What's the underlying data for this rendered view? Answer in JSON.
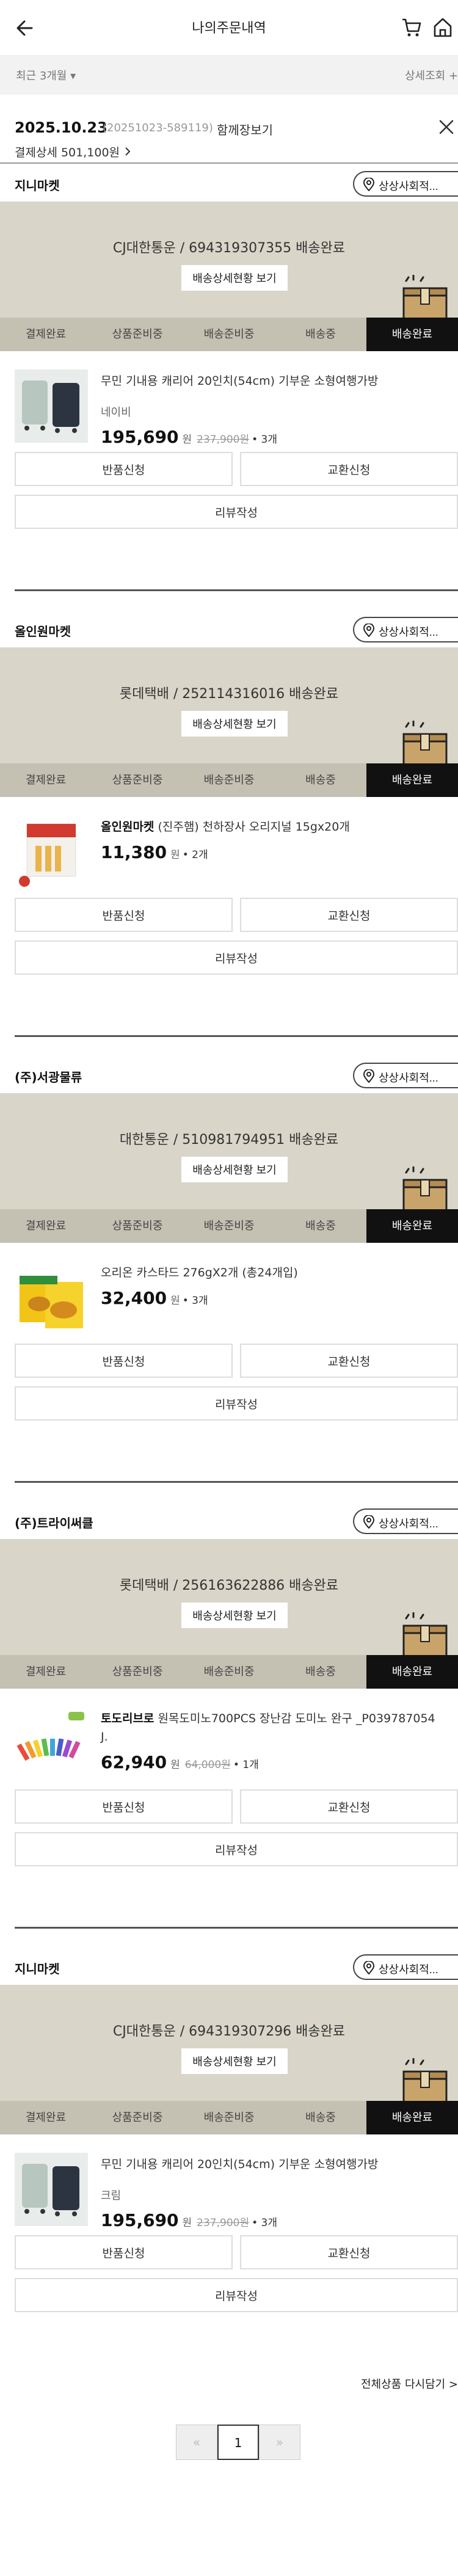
{
  "header": {
    "title": "나의주문내역"
  },
  "filter": {
    "period_label": "최근 3개월 ▾",
    "detail_search_label": "상세조회 +"
  },
  "order": {
    "date": "2025.10.23",
    "order_no": "(20251023-589119)",
    "together_label": "함께장보기",
    "pay_detail_label": "결제상세 501,100원"
  },
  "steps": [
    "결제완료",
    "상품준비중",
    "배송준비중",
    "배송중",
    "배송완료"
  ],
  "shipments": [
    {
      "seller": "지니마켓",
      "store_btn": "상상사회적...",
      "carrier_line": "CJ대한통운 / 694319307355 배송완료",
      "detail_btn": "배송상세현황 보기",
      "item": {
        "brand": "",
        "name": "무민 기내용 캐리어 20인치(54cm) 기부운 소형여행가방",
        "option": "네이비",
        "price": "195,690",
        "won": "원",
        "orig": "237,900원",
        "qty": "• 3개"
      },
      "return_btn": "반품신청",
      "exchange_btn": "교환신청",
      "review_btn": "리뷰작성"
    },
    {
      "seller": "올인원마켓",
      "store_btn": "상상사회적...",
      "carrier_line": "롯데택배 / 252114316016 배송완료",
      "detail_btn": "배송상세현황 보기",
      "item": {
        "brand": "올인원마켓",
        "name": " (진주햄) 천하장사 오리지널 15gx20개",
        "option": "",
        "price": "11,380",
        "won": "원",
        "orig": "",
        "qty": "• 2개"
      },
      "return_btn": "반품신청",
      "exchange_btn": "교환신청",
      "review_btn": "리뷰작성"
    },
    {
      "seller": "(주)서광물류",
      "store_btn": "상상사회적...",
      "carrier_line": "대한통운 / 510981794951 배송완료",
      "detail_btn": "배송상세현황 보기",
      "item": {
        "brand": "",
        "name": "오리온 카스타드 276gX2개 (총24개입)",
        "option": "",
        "price": "32,400",
        "won": "원",
        "orig": "",
        "qty": "• 3개"
      },
      "return_btn": "반품신청",
      "exchange_btn": "교환신청",
      "review_btn": "리뷰작성"
    },
    {
      "seller": "(주)트라이써클",
      "store_btn": "상상사회적...",
      "carrier_line": "롯데택배 / 256163622886 배송완료",
      "detail_btn": "배송상세현황 보기",
      "item": {
        "brand": "토도리브로",
        "name": " 원목도미노700PCS 장난감 도미노 완구 _P039787054 J.",
        "option": "",
        "price": "62,940",
        "won": "원",
        "orig": "64,000원",
        "qty": "• 1개"
      },
      "return_btn": "반품신청",
      "exchange_btn": "교환신청",
      "review_btn": "리뷰작성"
    },
    {
      "seller": "지니마켓",
      "store_btn": "상상사회적...",
      "carrier_line": "CJ대한통운 / 694319307296 배송완료",
      "detail_btn": "배송상세현황 보기",
      "item": {
        "brand": "",
        "name": "무민 기내용 캐리어 20인치(54cm) 기부운 소형여행가방",
        "option": "크림",
        "price": "195,690",
        "won": "원",
        "orig": "237,900원",
        "qty": "• 3개"
      },
      "return_btn": "반품신청",
      "exchange_btn": "교환신청",
      "review_btn": "리뷰작성"
    }
  ],
  "readd_label": "전체상품 다시담기 >",
  "pager": {
    "prev": "«",
    "current": "1",
    "next": "»"
  },
  "colors": {
    "track_bg": "#d9d5c8",
    "steps_bg": "#c4c0b2",
    "active_step": "#111111"
  },
  "icons": [
    "back-arrow-icon",
    "cart-icon",
    "home-icon",
    "close-icon",
    "location-pin-icon",
    "delivery-box-icon"
  ]
}
